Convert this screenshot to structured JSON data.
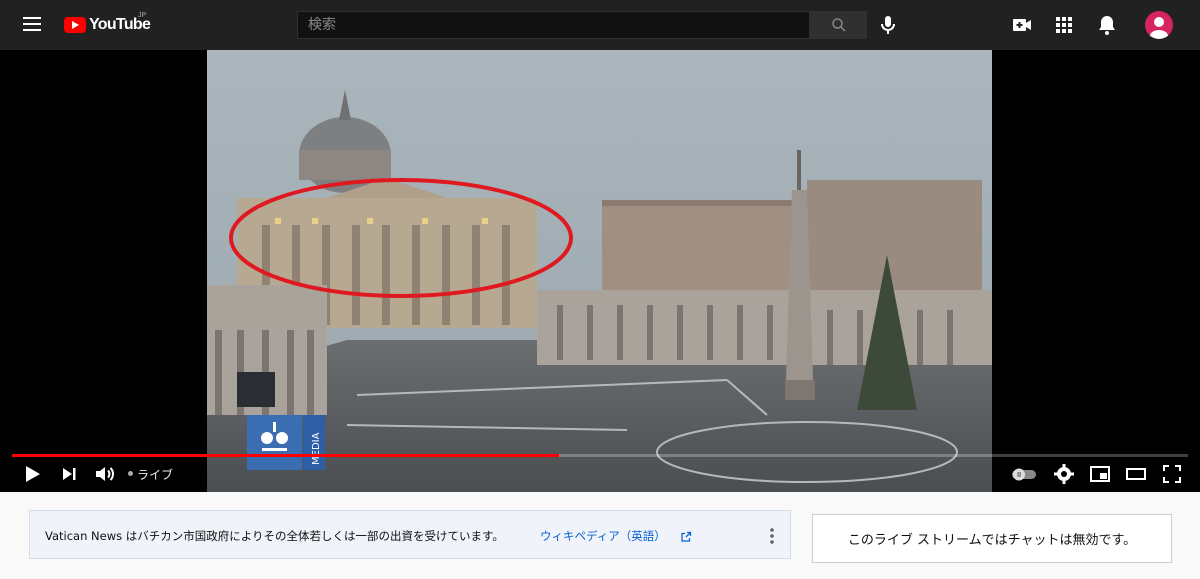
{
  "masthead": {
    "logo_text": "YouTube",
    "country_code": "JP",
    "search_placeholder": "検索"
  },
  "player": {
    "progress_fraction": 0.465,
    "live_label": "ライブ",
    "overlay_logo_text": "MEDIA"
  },
  "info_panel": {
    "text": "Vatican News はバチカン市国政府によりその全体若しくは一部の出資を受けています。",
    "link_text": "ウィキペディア（英語）"
  },
  "chat": {
    "message": "このライブ ストリームではチャットは無効です。"
  },
  "colors": {
    "brand_red": "#ff0000",
    "masthead_bg": "#212121",
    "link_blue": "#065fd4",
    "avatar_bg": "#d6245f"
  }
}
